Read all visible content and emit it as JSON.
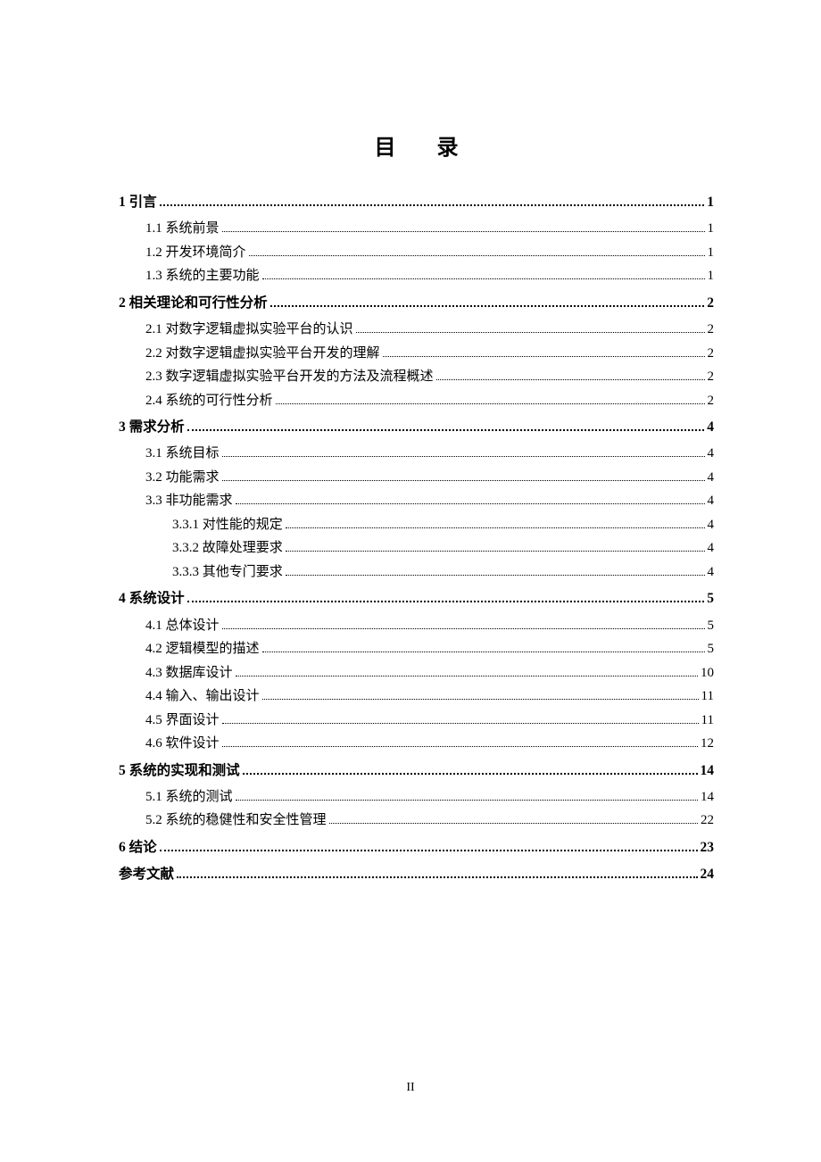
{
  "title": "目 录",
  "page_number": "II",
  "entries": [
    {
      "level": 0,
      "label": "1 引言",
      "page": "1"
    },
    {
      "level": 1,
      "label": "1.1 系统前景",
      "page": "1"
    },
    {
      "level": 1,
      "label": "1.2 开发环境简介",
      "page": "1"
    },
    {
      "level": 1,
      "label": "1.3 系统的主要功能",
      "page": "1"
    },
    {
      "level": 0,
      "label": "2  相关理论和可行性分析",
      "page": "2"
    },
    {
      "level": 1,
      "label": "2.1  对数字逻辑虚拟实验平台的认识",
      "page": "2"
    },
    {
      "level": 1,
      "label": "2.2  对数字逻辑虚拟实验平台开发的理解",
      "page": "2"
    },
    {
      "level": 1,
      "label": "2.3  数字逻辑虚拟实验平台开发的方法及流程概述",
      "page": "2"
    },
    {
      "level": 1,
      "label": "2.4  系统的可行性分析",
      "page": "2"
    },
    {
      "level": 0,
      "label": "3  需求分析",
      "page": "4"
    },
    {
      "level": 1,
      "label": "3.1  系统目标",
      "page": "4"
    },
    {
      "level": 1,
      "label": "3.2  功能需求",
      "page": "4"
    },
    {
      "level": 1,
      "label": "3.3  非功能需求",
      "page": "4"
    },
    {
      "level": 2,
      "label": "3.3.1  对性能的规定",
      "page": "4"
    },
    {
      "level": 2,
      "label": "3.3.2 故障处理要求",
      "page": "4"
    },
    {
      "level": 2,
      "label": "3.3.3 其他专门要求",
      "page": "4"
    },
    {
      "level": 0,
      "label": "4 系统设计",
      "page": "5"
    },
    {
      "level": 1,
      "label": "4.1 总体设计",
      "page": "5"
    },
    {
      "level": 1,
      "label": "4.2  逻辑模型的描述",
      "page": "5"
    },
    {
      "level": 1,
      "label": "4.3  数据库设计",
      "page": "10"
    },
    {
      "level": 1,
      "label": "4.4  输入、输出设计",
      "page": "11"
    },
    {
      "level": 1,
      "label": "4.5  界面设计",
      "page": "11"
    },
    {
      "level": 1,
      "label": "4.6  软件设计",
      "page": "12"
    },
    {
      "level": 0,
      "label": "5 系统的实现和测试",
      "page": "14"
    },
    {
      "level": 1,
      "label": "5.1 系统的测试",
      "page": "14"
    },
    {
      "level": 1,
      "label": "5.2  系统的稳健性和安全性管理",
      "page": "22"
    },
    {
      "level": 0,
      "label": "6 结论",
      "page": "23"
    },
    {
      "level": 0,
      "label": "参考文献",
      "page": "24"
    }
  ]
}
